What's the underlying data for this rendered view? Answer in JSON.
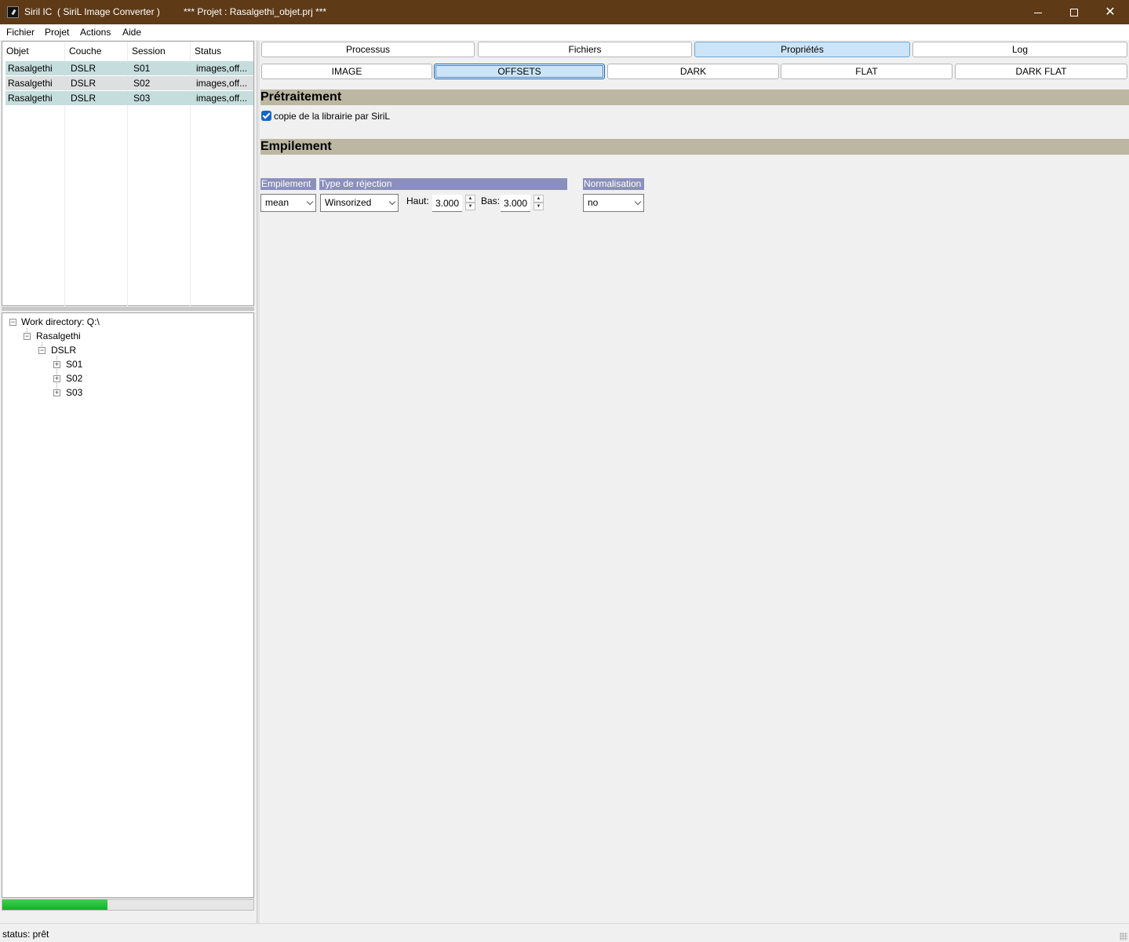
{
  "window": {
    "app_title": "Siril IC  ( SiriL Image Converter )",
    "project_title": "*** Projet : Rasalgethi_objet.prj ***",
    "close_glyph": "✕"
  },
  "menu": [
    "Fichier",
    "Projet",
    "Actions",
    "Aide"
  ],
  "list": {
    "columns": [
      "Objet",
      "Couche",
      "Session",
      "Status"
    ],
    "rows": [
      [
        "Rasalgethi",
        "DSLR",
        "S01",
        "images,off..."
      ],
      [
        "Rasalgethi",
        "DSLR",
        "S02",
        "images,off..."
      ],
      [
        "Rasalgethi",
        "DSLR",
        "S03",
        "images,off..."
      ]
    ]
  },
  "tree": {
    "root": "Work directory: Q:\\",
    "object": "Rasalgethi",
    "layer": "DSLR",
    "sessions": [
      "S01",
      "S02",
      "S03"
    ]
  },
  "progress": {
    "fraction": 0.42,
    "color": "#1fbf35"
  },
  "tabs": {
    "main": [
      "Processus",
      "Fichiers",
      "Propriétés",
      "Log"
    ],
    "main_active": "Propriétés",
    "sub": [
      "IMAGE",
      "OFFSETS",
      "DARK",
      "FLAT",
      "DARK FLAT"
    ],
    "sub_active": "OFFSETS"
  },
  "props": {
    "pretraitement_title": "Prétraitement",
    "copy_label": "copie de la librairie par SiriL",
    "copy_checked": true,
    "empilement_title": "Empilement",
    "stack_label": "Empilement",
    "stack_value": "mean",
    "rejection_label": "Type de réjection",
    "rejection_value": "Winsorized",
    "haut_label": "Haut:",
    "haut_value": "3.000",
    "bas_label": "Bas:",
    "bas_value": "3.000",
    "norm_label": "Normalisation",
    "norm_value": "no"
  },
  "status": "status: prêt",
  "colors": {
    "titlebar": "#5e3a17",
    "section": "#bbb7a2",
    "group_label": "#8b8fbd",
    "selected_row": "#c5dedd",
    "active_tab": "#cce4f7"
  }
}
